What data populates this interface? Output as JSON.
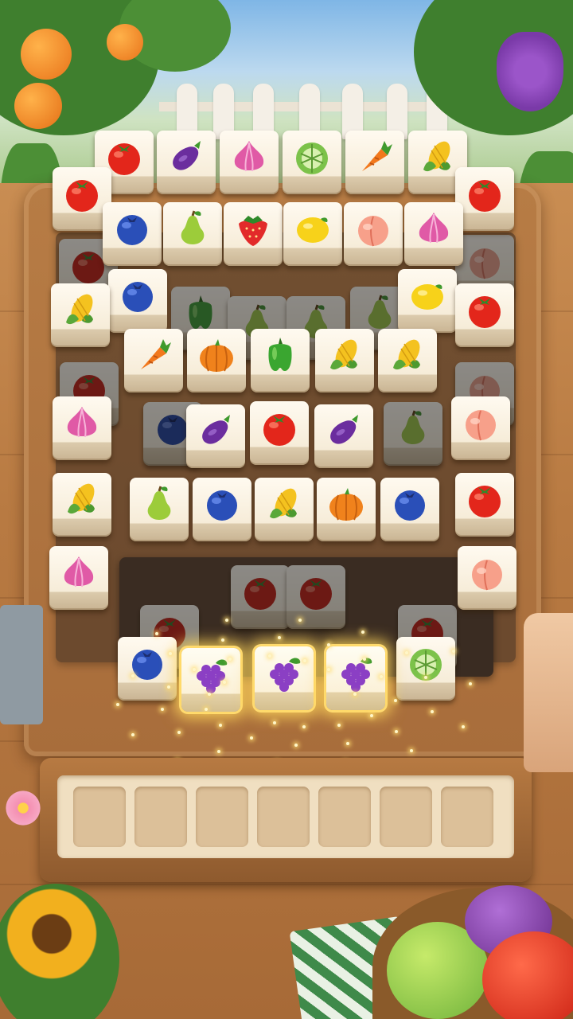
{
  "game": {
    "title": "",
    "mode": "tile-match"
  },
  "colors": {
    "board": "#b77c45",
    "tile_face": "#fffaf0",
    "tray": "#b77a42",
    "slot": "#dcc099",
    "glow": "#ffd65a"
  },
  "board": {
    "tiles": [
      {
        "fruit": "tomato",
        "row": 0,
        "col": 0
      },
      {
        "fruit": "eggplant",
        "row": 0,
        "col": 1
      },
      {
        "fruit": "onion",
        "row": 0,
        "col": 2
      },
      {
        "fruit": "cabbage",
        "row": 0,
        "col": 3
      },
      {
        "fruit": "carrot",
        "row": 0,
        "col": 4
      },
      {
        "fruit": "corn",
        "row": 0,
        "col": 5
      },
      {
        "fruit": "tomato",
        "row": 0,
        "col": 6,
        "note": "left-edge"
      },
      {
        "fruit": "tomato",
        "row": 0,
        "col": 7,
        "note": "right-edge"
      },
      {
        "fruit": "blueberry",
        "row": 1,
        "col": 0
      },
      {
        "fruit": "pear",
        "row": 1,
        "col": 1
      },
      {
        "fruit": "strawberry",
        "row": 1,
        "col": 2
      },
      {
        "fruit": "lemon",
        "row": 1,
        "col": 3
      },
      {
        "fruit": "peach",
        "row": 1,
        "col": 4
      },
      {
        "fruit": "onion",
        "row": 1,
        "col": 5
      },
      {
        "fruit": "blueberry",
        "row": 2,
        "col": 0
      },
      {
        "fruit": "lemon",
        "row": 2,
        "col": 1
      },
      {
        "fruit": "corn",
        "row": 2,
        "col": 2
      },
      {
        "fruit": "tomato",
        "row": 2,
        "col": 3
      },
      {
        "fruit": "carrot",
        "row": 3,
        "col": 0
      },
      {
        "fruit": "pumpkin",
        "row": 3,
        "col": 1
      },
      {
        "fruit": "pepper",
        "row": 3,
        "col": 2
      },
      {
        "fruit": "corn",
        "row": 3,
        "col": 3
      },
      {
        "fruit": "corn",
        "row": 3,
        "col": 4
      },
      {
        "fruit": "onion",
        "row": 4,
        "col": 0
      },
      {
        "fruit": "eggplant",
        "row": 4,
        "col": 1
      },
      {
        "fruit": "tomato",
        "row": 4,
        "col": 2
      },
      {
        "fruit": "eggplant",
        "row": 4,
        "col": 3
      },
      {
        "fruit": "peach",
        "row": 4,
        "col": 4
      },
      {
        "fruit": "corn",
        "row": 5,
        "col": 0
      },
      {
        "fruit": "pear",
        "row": 5,
        "col": 1
      },
      {
        "fruit": "blueberry",
        "row": 5,
        "col": 2
      },
      {
        "fruit": "corn",
        "row": 5,
        "col": 3
      },
      {
        "fruit": "pumpkin",
        "row": 5,
        "col": 4
      },
      {
        "fruit": "blueberry",
        "row": 5,
        "col": 5
      },
      {
        "fruit": "tomato",
        "row": 5,
        "col": 6
      },
      {
        "fruit": "onion",
        "row": 6,
        "col": 0
      },
      {
        "fruit": "peach",
        "row": 6,
        "col": 1
      },
      {
        "fruit": "blueberry",
        "row": 7,
        "col": 0
      },
      {
        "fruit": "cabbage",
        "row": 7,
        "col": 1
      }
    ],
    "dim_tiles": [
      "tomato",
      "pepper",
      "tomato",
      "blueberry",
      "pear",
      "peach",
      "pear",
      "pear",
      "pear",
      "peach",
      "tomato",
      "tomato",
      "tomato",
      "tomato"
    ],
    "matched_tiles": [
      "grapes",
      "grapes",
      "grapes"
    ]
  },
  "tray": {
    "slot_count": 7,
    "filled": 0
  }
}
